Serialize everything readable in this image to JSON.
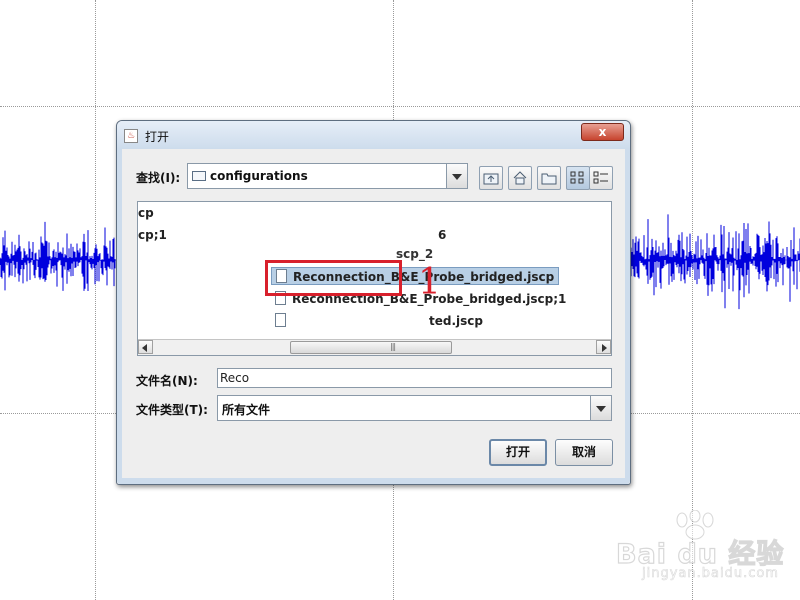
{
  "dialog": {
    "title": "打开",
    "close_glyph": "x",
    "look_in_label": "查找(I):",
    "look_in_value": "configurations",
    "toolbar_icons": [
      "up-one-level-icon",
      "home-icon",
      "new-folder-icon",
      "list-view-icon",
      "details-view-icon"
    ],
    "files": {
      "left_col": [
        "cp",
        "cp;1"
      ],
      "partial_top": "6",
      "partial_second": "scp_2",
      "selected": "Reconnection_B&E_Probe_bridged.jscp",
      "next": "Reconnection_B&E_Probe_bridged.jscp;1",
      "third_partial": "ted.jscp"
    },
    "filename_label": "文件名(N):",
    "filename_value": "Reco",
    "filetype_label": "文件类型(T):",
    "filetype_value": "所有文件",
    "open_button": "打开",
    "cancel_button": "取消"
  },
  "annotation": {
    "number": "1",
    "color": "#d8202c"
  },
  "watermark": {
    "brand": "Bai du 经验",
    "url": "jingyan.baidu.com"
  },
  "colors": {
    "waveform": "#0000dd",
    "selection": "#b8cfe5",
    "annotation": "#d8202c"
  }
}
